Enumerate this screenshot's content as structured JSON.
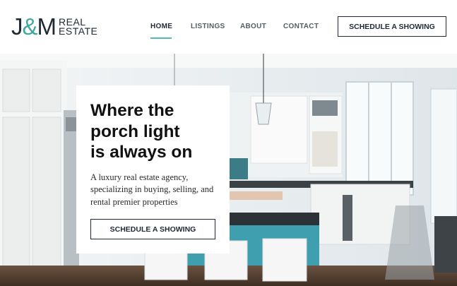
{
  "logo": {
    "mark_j": "J",
    "mark_amp": "&",
    "mark_m": "M",
    "line1": "REAL",
    "line2": "ESTATE"
  },
  "nav": {
    "items": [
      {
        "label": "HOME",
        "active": true
      },
      {
        "label": "LISTINGS",
        "active": false
      },
      {
        "label": "ABOUT",
        "active": false
      },
      {
        "label": "CONTACT",
        "active": false
      }
    ],
    "cta_label": "SCHEDULE A SHOWING"
  },
  "hero": {
    "title_lines": [
      "Where the",
      "porch light",
      "is always on"
    ],
    "body_lines": [
      "A luxury real estate agency,",
      "specializing in buying, selling, and",
      "rental premier properties"
    ],
    "cta_label": "SCHEDULE A SHOWING",
    "image": "kitchen-interior"
  },
  "colors": {
    "primary_dark": "#1f2a36",
    "accent_teal": "#41a6a0"
  }
}
